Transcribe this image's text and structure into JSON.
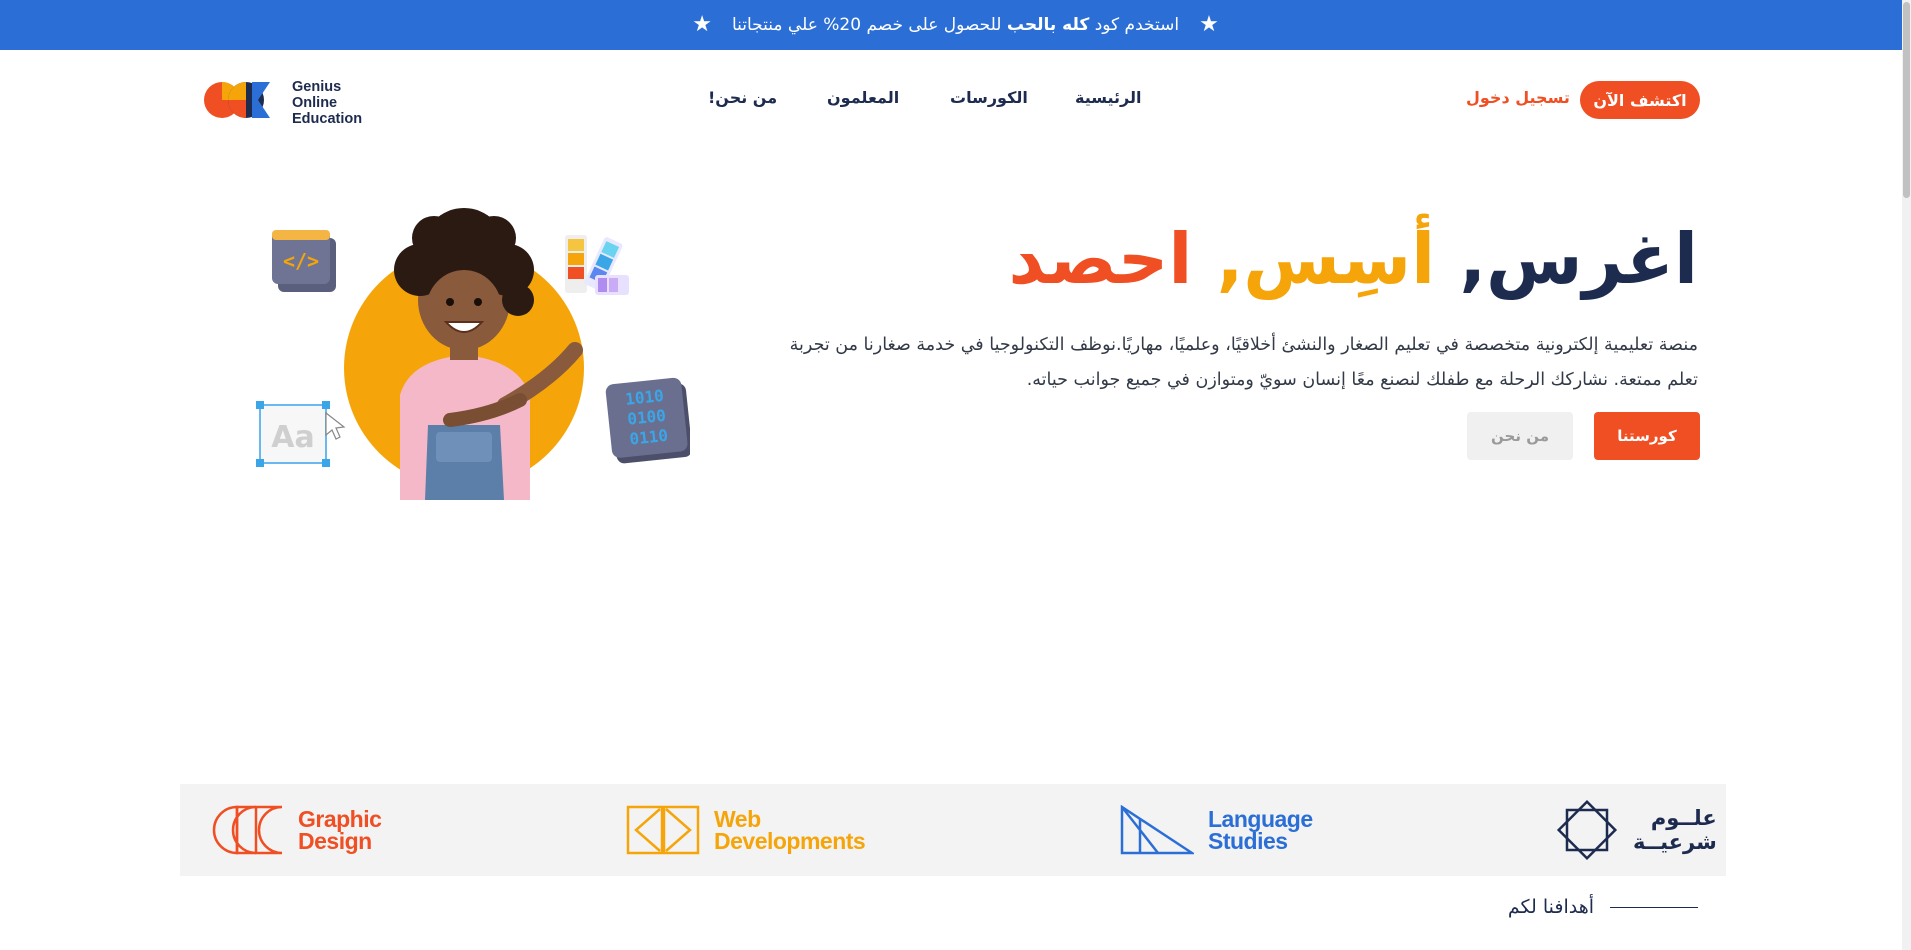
{
  "promo": {
    "prefix": "استخدم كود",
    "code": "كله بالحب",
    "suffix": "للحصول على خصم 20% علي منتجاتنا",
    "star_icon": "star-icon"
  },
  "brand": {
    "line1": "Genius",
    "line2": "Online",
    "line3": "Education",
    "colors": {
      "navy": "#1d2b4f",
      "orange": "#f04e23",
      "yellow": "#f5a50a",
      "blue": "#2b6fd6"
    }
  },
  "nav": {
    "home": "الرئيسية",
    "courses": "الكورسات",
    "teachers": "المعلمون",
    "about": "من نحن!",
    "login": "تسجيل دخول",
    "explore": "اكتشف الآن"
  },
  "hero": {
    "headline_part1": "اغرس,",
    "headline_part2": "أسِس,",
    "headline_part3": "احصد",
    "description": "منصة تعليمية إلكترونية متخصصة في تعليم الصغار والنشئ أخلاقيًا، وعلميًا، مهاريًا.نوظف التكنولوجيا في خدمة صغارنا من تجربة تعلم ممتعة. نشاركك الرحلة مع طفلك لنصنع معًا إنسان سويّ ومتوازن في جميع جوانب حياته.",
    "btn_courses": "كورستنا",
    "btn_about": "من نحن",
    "code_badge": "</>",
    "binary": [
      "1010",
      "0100",
      "0110"
    ],
    "font_badge": "Aa"
  },
  "categories": {
    "graphic": {
      "line1": "Graphic",
      "line2": "Design"
    },
    "web": {
      "line1": "Web",
      "line2": "Developments"
    },
    "language": {
      "line1": "Language",
      "line2": "Studies"
    },
    "sharia": {
      "line1": "علــوم",
      "line2": "شرعيــة"
    }
  },
  "goals": {
    "title": "أهدافنا لكم"
  }
}
